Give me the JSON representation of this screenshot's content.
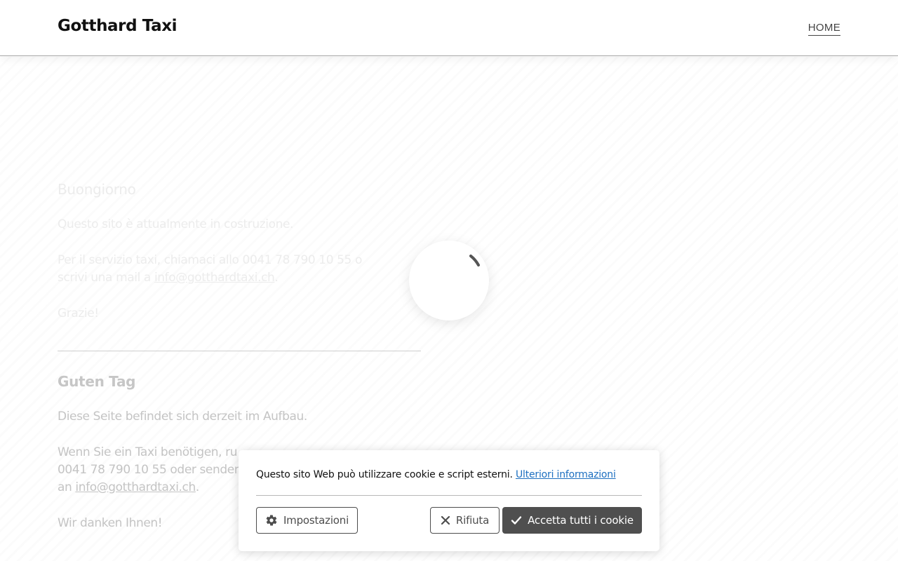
{
  "header": {
    "logo": "Gotthard Taxi",
    "nav": {
      "home_label": "HOME"
    }
  },
  "content": {
    "italian": {
      "heading": "Buongiorno",
      "line1": "Questo sito è attualmente in costruzione.",
      "line2a": "Per il servizio taxi, chiamaci allo 0041 78 790 10 55 o",
      "line2b": "scrivi una mail a ",
      "email": "info@gotthardtaxi.ch",
      "period": ".",
      "thanks": "Grazie!"
    },
    "german": {
      "heading": "Guten Tag",
      "line1": "Diese Seite befindet sich derzeit im Aufbau.",
      "line2a": "Wenn Sie ein Taxi benötigen, ru",
      "line2b": "0041 78 790 10 55 oder senden S",
      "line2c": "an ",
      "email": "info@gotthardtaxi.ch",
      "period": ".",
      "thanks": "Wir danken Ihnen!"
    }
  },
  "loading": {
    "icon": "loading-spinner-icon"
  },
  "cookie_banner": {
    "message": "Questo sito Web può utilizzare cookie e script esterni. ",
    "more_info_link": "Ulteriori informazioni",
    "settings_button": "Impostazioni",
    "reject_button": "Rifiuta",
    "accept_button": "Accetta tutti i cookie",
    "icons": {
      "settings": "gear-icon",
      "reject": "close-icon",
      "accept": "checkmark-icon"
    },
    "colors": {
      "link": "#1d6fc0",
      "accept_bg": "#4f4f4f"
    }
  }
}
